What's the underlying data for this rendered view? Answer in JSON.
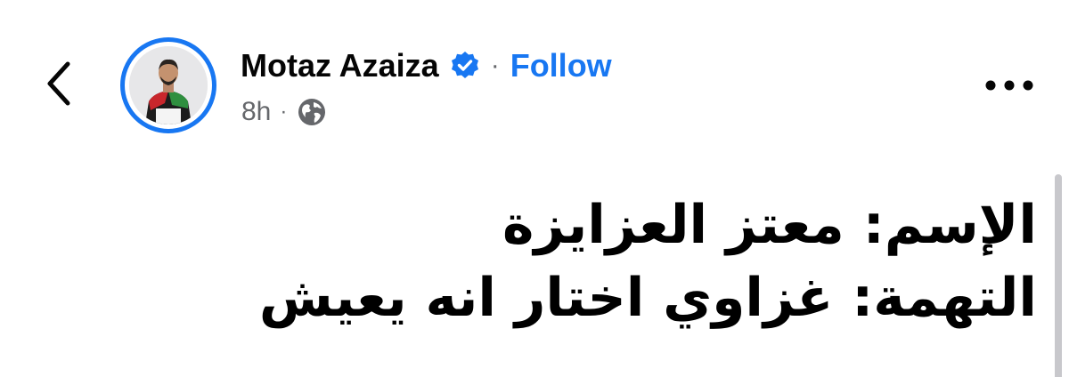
{
  "nav": {
    "back_icon": "chevron-left-icon"
  },
  "post": {
    "author_name": "Motaz Azaiza",
    "verified_icon": "verified-badge-icon",
    "separator": "·",
    "follow_label": "Follow",
    "time_ago": "8h",
    "audience_icon": "globe-icon",
    "more_icon": "more-horizontal-icon",
    "body_lines": [
      "الإسم: معتز العزايزة",
      "التهمة: غزاوي اختار انه يعيش"
    ]
  },
  "colors": {
    "accent": "#1877f2",
    "secondary_text": "#65676b",
    "primary_text": "#050505",
    "background": "#ffffff"
  }
}
